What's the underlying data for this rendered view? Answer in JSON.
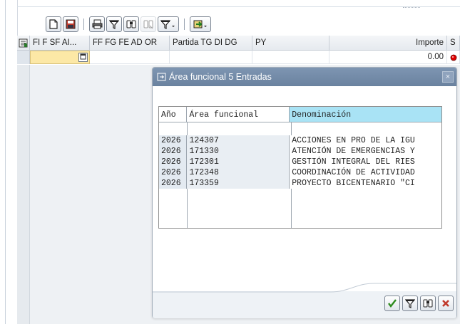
{
  "toolbar": {
    "icons": [
      "new-document-icon",
      "save-icon",
      "print-icon",
      "filter-icon",
      "find-icon",
      "find-next-icon",
      "filter-dropdown-icon",
      "export-icon"
    ]
  },
  "grid": {
    "columns": [
      "FI F SF AI...",
      "FF FG FE AD OR",
      "Partida TG DI DG",
      "PY",
      "Importe",
      "S"
    ],
    "row": {
      "importe": "0.00"
    }
  },
  "dialog": {
    "title": "Área funcional 5 Entradas",
    "close_label": "×",
    "list": {
      "headers": [
        "Año",
        "Área funcional",
        "Denominación"
      ],
      "rows": [
        [
          "2026",
          "124307",
          "ACCIONES EN PRO DE LA IGU"
        ],
        [
          "2026",
          "171330",
          "ATENCIÓN DE EMERGENCIAS Y"
        ],
        [
          "2026",
          "172301",
          "GESTIÓN INTEGRAL DEL RIES"
        ],
        [
          "2026",
          "172348",
          "COORDINACIÓN DE ACTIVIDAD"
        ],
        [
          "2026",
          "173359",
          "PROYECTO BICENTENARIO \"CI"
        ]
      ]
    },
    "footer": {
      "confirm_icon": "check-icon",
      "filter_icon": "filter-icon",
      "find_icon": "find-icon",
      "cancel_icon": "cancel-icon"
    }
  },
  "colors": {
    "title_bar": "#7189a6",
    "input_highlight": "#fce8a6",
    "header_highlight": "#a9e3f5",
    "status_red": "#e00000"
  }
}
